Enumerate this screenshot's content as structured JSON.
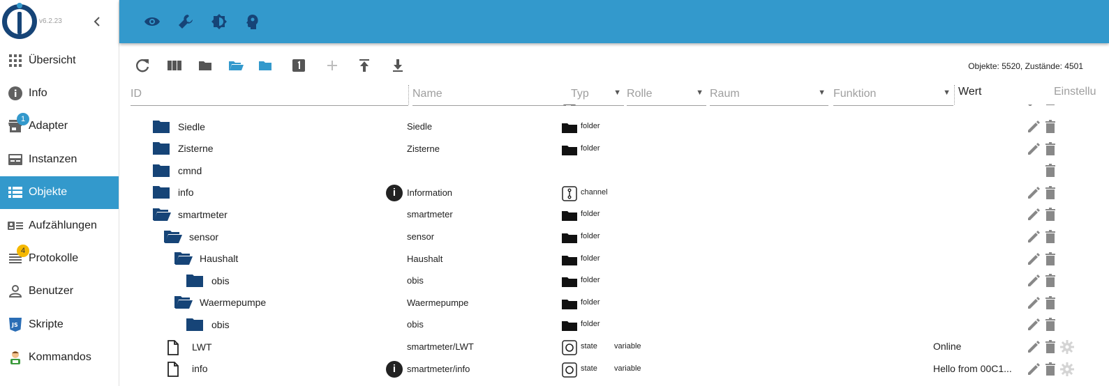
{
  "app": {
    "version": "v6.2.23"
  },
  "sidebar": {
    "items": [
      {
        "label": "Übersicht",
        "icon": "grid-icon"
      },
      {
        "label": "Info",
        "icon": "info-icon"
      },
      {
        "label": "Adapter",
        "icon": "store-icon",
        "badge": "1",
        "badge_color": "#3399cc"
      },
      {
        "label": "Instanzen",
        "icon": "instances-icon"
      },
      {
        "label": "Objekte",
        "icon": "list-icon",
        "active": true
      },
      {
        "label": "Aufzählungen",
        "icon": "enum-icon"
      },
      {
        "label": "Protokolle",
        "icon": "log-icon",
        "badge": "4",
        "badge_color": "#f5b800"
      },
      {
        "label": "Benutzer",
        "icon": "user-icon"
      },
      {
        "label": "Skripte",
        "icon": "js-icon"
      },
      {
        "label": "Kommandos",
        "icon": "command-icon"
      }
    ]
  },
  "topbar": {
    "icons": [
      "eye-icon",
      "wrench-icon",
      "theme-icon",
      "expert-icon"
    ]
  },
  "toolbar": {
    "object_count": "Objekte: 5520, Zustände: 4501"
  },
  "filters": {
    "id": "ID",
    "name": "Name",
    "type": "Typ",
    "role": "Rolle",
    "room": "Raum",
    "function": "Funktion",
    "value": "Wert",
    "settings": "Einstellu"
  },
  "rows": [
    {
      "id": "Siedle",
      "name": "Siedle",
      "type": "folder",
      "role": "",
      "value": ""
    },
    {
      "id": "Zisterne",
      "name": "Zisterne",
      "type": "folder",
      "role": "",
      "value": ""
    },
    {
      "id": "cmnd",
      "name": "",
      "type": "",
      "role": "",
      "value": ""
    },
    {
      "id": "info",
      "name": "Information",
      "type": "channel",
      "role": "",
      "value": ""
    },
    {
      "id": "smartmeter",
      "name": "smartmeter",
      "type": "folder",
      "role": "",
      "value": ""
    },
    {
      "id": "sensor",
      "name": "sensor",
      "type": "folder",
      "role": "",
      "value": ""
    },
    {
      "id": "Haushalt",
      "name": "Haushalt",
      "type": "folder",
      "role": "",
      "value": ""
    },
    {
      "id": "obis",
      "name": "obis",
      "type": "folder",
      "role": "",
      "value": ""
    },
    {
      "id": "Waermepumpe",
      "name": "Waermepumpe",
      "type": "folder",
      "role": "",
      "value": ""
    },
    {
      "id": "obis",
      "name": "obis",
      "type": "folder",
      "role": "",
      "value": ""
    },
    {
      "id": "LWT",
      "name": "smartmeter/LWT",
      "type": "state",
      "role": "variable",
      "value": "Online"
    },
    {
      "id": "info",
      "name": "smartmeter/info",
      "type": "state",
      "role": "variable",
      "value": "Hello from 00C1..."
    }
  ],
  "colors": {
    "accent": "#3399cc",
    "folder": "#164477"
  }
}
